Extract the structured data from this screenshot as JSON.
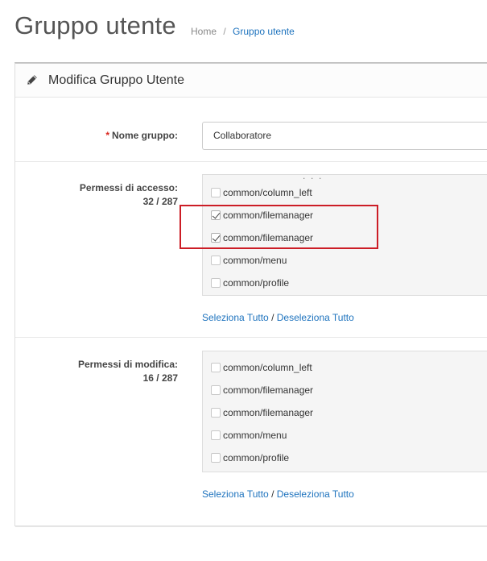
{
  "page": {
    "title": "Gruppo utente",
    "breadcrumb": [
      {
        "label": "Home"
      },
      {
        "separator": "/",
        "label": "Gruppo utente"
      }
    ]
  },
  "panel": {
    "heading": "Modifica Gruppo Utente",
    "icon": "pencil-icon",
    "group_name": {
      "required_mark": "*",
      "label": "Nome gruppo:",
      "value": "Collaboratore"
    },
    "access": {
      "label": "Permessi di accesso:",
      "count": "32 / 287",
      "items": [
        {
          "label": "common/column_left",
          "checked": false
        },
        {
          "label": "common/filemanager",
          "checked": true
        },
        {
          "label": "common/filemanager",
          "checked": true
        },
        {
          "label": "common/menu",
          "checked": false
        },
        {
          "label": "common/profile",
          "checked": false
        }
      ],
      "select_all": "Seleziona Tutto",
      "separator": " / ",
      "deselect_all": "Deseleziona Tutto"
    },
    "modify": {
      "label": "Permessi di modifica:",
      "count": "16 / 287",
      "items": [
        {
          "label": "common/column_left",
          "checked": false
        },
        {
          "label": "common/filemanager",
          "checked": false
        },
        {
          "label": "common/filemanager",
          "checked": false
        },
        {
          "label": "common/menu",
          "checked": false
        },
        {
          "label": "common/profile",
          "checked": false
        }
      ],
      "select_all": "Seleziona Tutto",
      "separator": " / ",
      "deselect_all": "Deseleziona Tutto"
    }
  },
  "colors": {
    "link": "#1e73be",
    "required": "#d9251d",
    "highlight": "#cc1d26"
  }
}
